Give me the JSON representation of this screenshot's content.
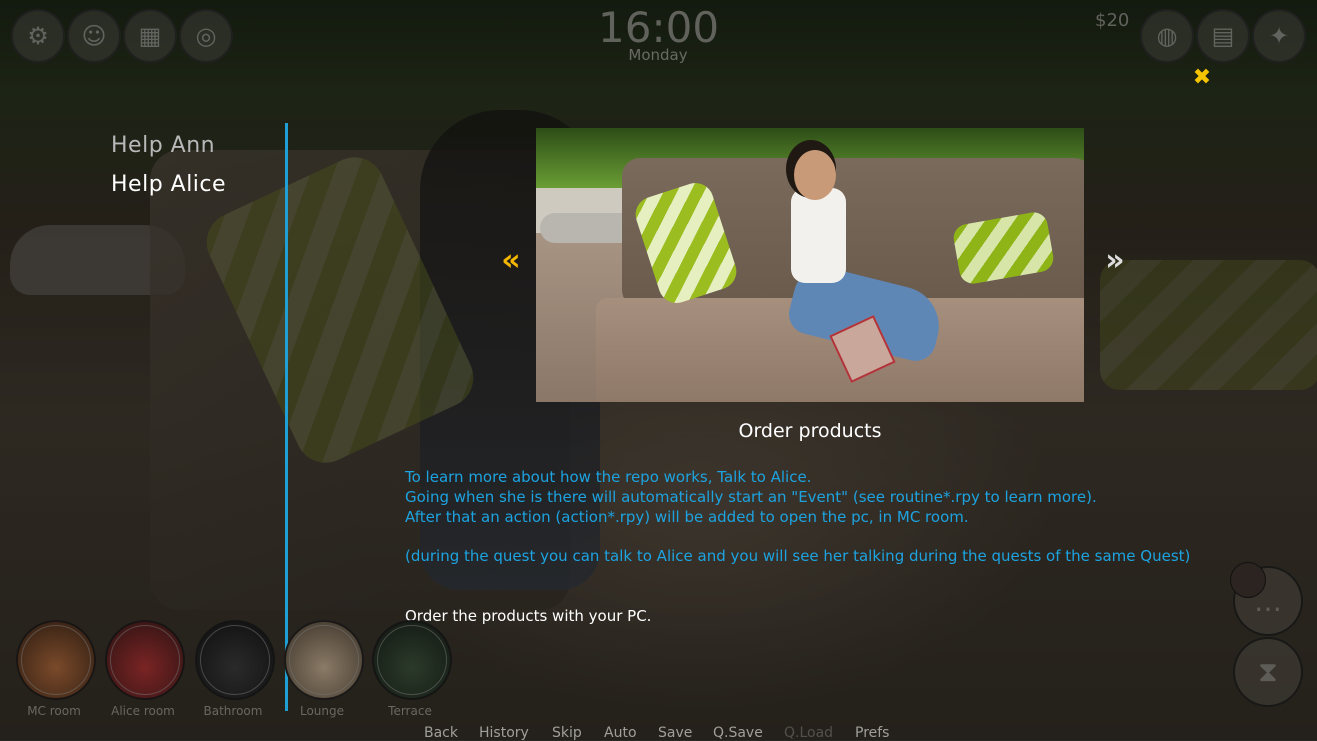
{
  "hud": {
    "time": "16:00",
    "day": "Monday",
    "money": "$20",
    "left_icons": [
      "settings-icon",
      "contacts-icon",
      "calendar-icon",
      "lifebuoy-icon"
    ],
    "right_icons": [
      "map-icon",
      "book-icon",
      "gift-icon"
    ]
  },
  "quest_list": {
    "items": [
      {
        "label": "Help Ann",
        "state": "inactive"
      },
      {
        "label": "Help Alice",
        "state": "active"
      }
    ]
  },
  "quest": {
    "title": "Order products",
    "description": [
      "To learn more about how the repo works, Talk to Alice.",
      "Going when she is there will automatically start an \"Event\" (see routine*.rpy to learn more).",
      "After that an action (action*.rpy) will be added to open the pc, in MC room.",
      "",
      "(during the quest you can talk to Alice and you will see her talking during the quests of the same Quest)"
    ],
    "objective": "Order the products with your PC.",
    "prev_arrow": "«",
    "next_arrow": "»"
  },
  "close_icon": "✖",
  "locations": [
    {
      "label": "MC room",
      "color": "#7a4a2a"
    },
    {
      "label": "Alice room",
      "color": "#7a2424"
    },
    {
      "label": "Bathroom",
      "color": "#2a2a2a"
    },
    {
      "label": "Lounge",
      "color": "#8a7a66"
    },
    {
      "label": "Terrace",
      "color": "#2b3a2a"
    }
  ],
  "side_buttons": [
    "chat-icon",
    "hourglass-icon"
  ],
  "quick_menu": [
    {
      "label": "Back",
      "enabled": true
    },
    {
      "label": "History",
      "enabled": true
    },
    {
      "label": "Skip",
      "enabled": true
    },
    {
      "label": "Auto",
      "enabled": true
    },
    {
      "label": "Save",
      "enabled": true
    },
    {
      "label": "Q.Save",
      "enabled": true
    },
    {
      "label": "Q.Load",
      "enabled": false
    },
    {
      "label": "Prefs",
      "enabled": true
    }
  ],
  "colors": {
    "accent_blue": "#1f9fd4",
    "description_blue": "#1da3e0",
    "close_yellow": "#f5c400",
    "prev_arrow_yellow": "#f5b800"
  }
}
